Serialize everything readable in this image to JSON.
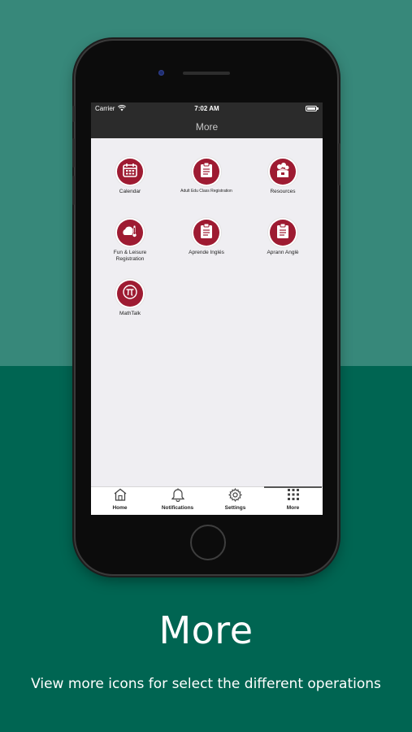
{
  "status": {
    "carrier": "Carrier",
    "time": "7:02 AM"
  },
  "nav": {
    "title": "More"
  },
  "tiles": [
    {
      "label": "Calendar",
      "icon": "calendar-icon"
    },
    {
      "label": "Adult Edu Class Registration",
      "icon": "clipboard-icon"
    },
    {
      "label": "Resources",
      "icon": "resources-box-icon"
    },
    {
      "label": "Fun & Leisure Registration",
      "icon": "cloud-thermometer-icon"
    },
    {
      "label": "Aprende Inglés",
      "icon": "clipboard-icon"
    },
    {
      "label": "Aprann Anglè",
      "icon": "clipboard-icon"
    },
    {
      "label": "MathTalk",
      "icon": "pi-icon"
    }
  ],
  "tabs": [
    {
      "label": "Home",
      "icon": "home-icon"
    },
    {
      "label": "Notifications",
      "icon": "bell-icon"
    },
    {
      "label": "Settings",
      "icon": "gear-icon"
    },
    {
      "label": "More",
      "icon": "grid-icon",
      "active": true
    }
  ],
  "caption": {
    "title": "More",
    "text": "View more icons for select the different operations"
  },
  "colors": {
    "background_top": "#37887a",
    "background_bottom": "#006552",
    "accent": "#9e1b32",
    "bar": "#2b2b2b"
  }
}
